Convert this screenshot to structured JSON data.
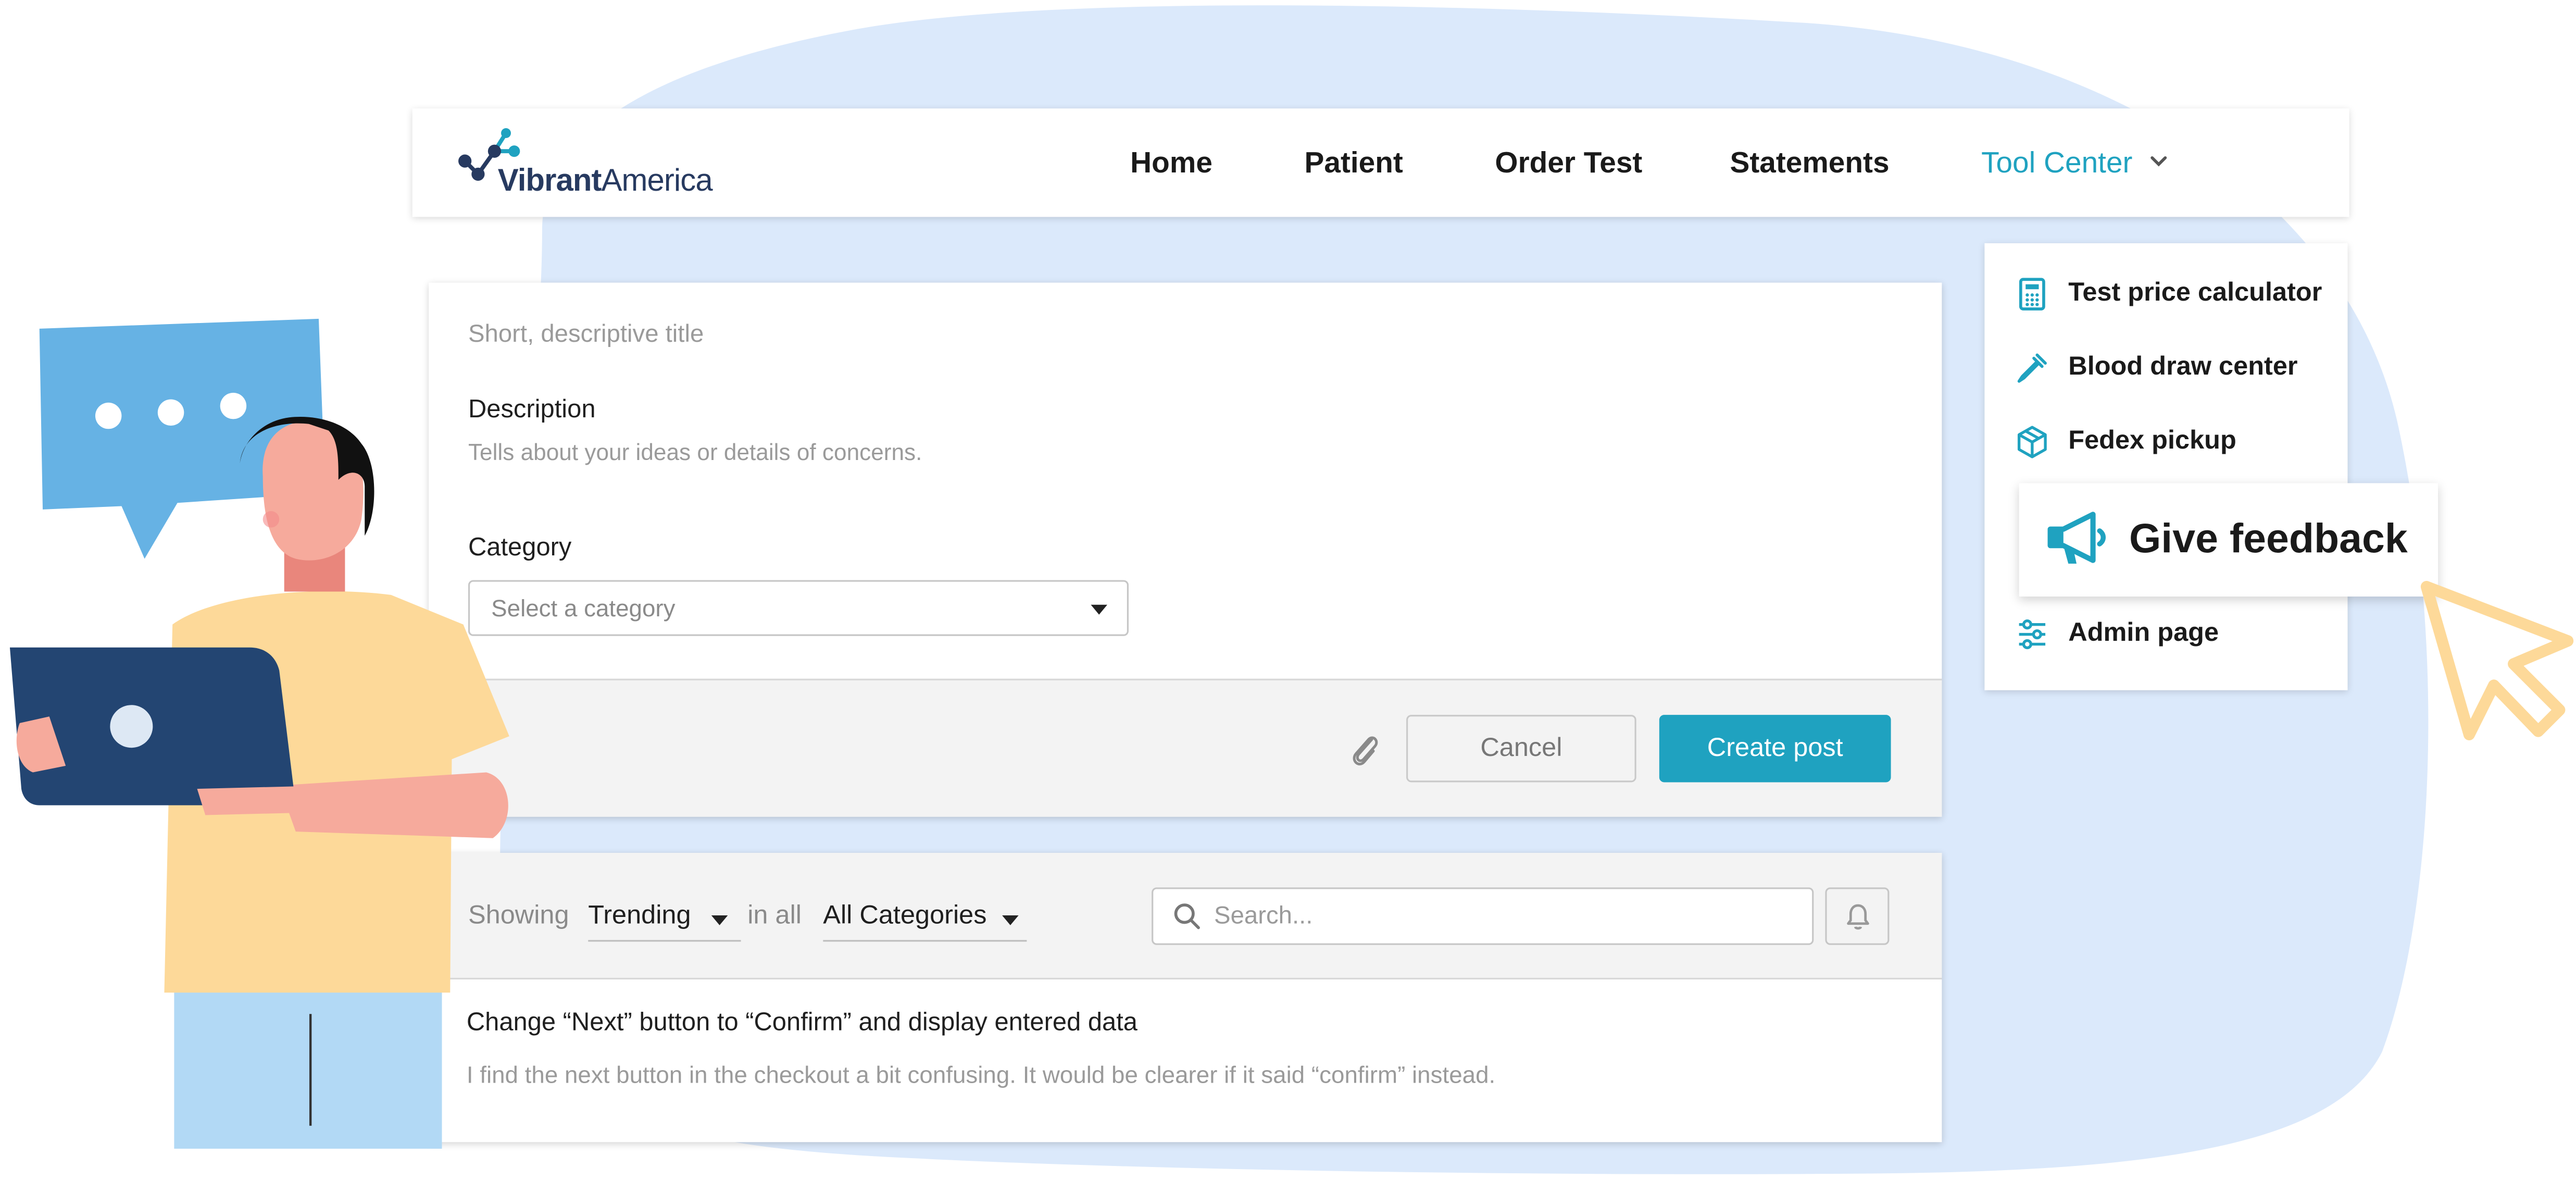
{
  "brand": {
    "name_bold": "Vibrant",
    "name_light": "America"
  },
  "nav": {
    "items": [
      {
        "label": "Home"
      },
      {
        "label": "Patient"
      },
      {
        "label": "Order Test"
      },
      {
        "label": "Statements"
      },
      {
        "label": "Tool Center",
        "active": true,
        "icon": "chevron-down-icon"
      }
    ]
  },
  "tool_menu": {
    "items": [
      {
        "label": "Test price calculator",
        "icon": "calculator-icon"
      },
      {
        "label": "Blood draw center",
        "icon": "pipette-icon"
      },
      {
        "label": "Fedex pickup",
        "icon": "package-icon"
      },
      {
        "label": "Give feedback",
        "icon": "megaphone-icon",
        "highlighted": true
      },
      {
        "label": "Admin page",
        "icon": "sliders-icon"
      }
    ]
  },
  "post_form": {
    "title_placeholder": "Short, descriptive title",
    "description_label": "Description",
    "description_placeholder": "Tells about your ideas or details of concerns.",
    "category_label": "Category",
    "category_placeholder": "Select a category",
    "cancel_label": "Cancel",
    "create_label": "Create post"
  },
  "filters": {
    "showing_label": "Showing",
    "sort_value": "Trending",
    "in_all_label": "in all",
    "category_value": "All Categories",
    "search_placeholder": "Search..."
  },
  "posts": [
    {
      "title": "Change “Next” button to “Confirm” and display entered data",
      "body": "I find the next button in the checkout a bit confusing. It would be clearer if it said “confirm” instead."
    }
  ],
  "colors": {
    "accent": "#1fa2c0",
    "blob": "#dbe9fb",
    "cursor": "#fdd999",
    "brand_navy": "#273a60"
  }
}
